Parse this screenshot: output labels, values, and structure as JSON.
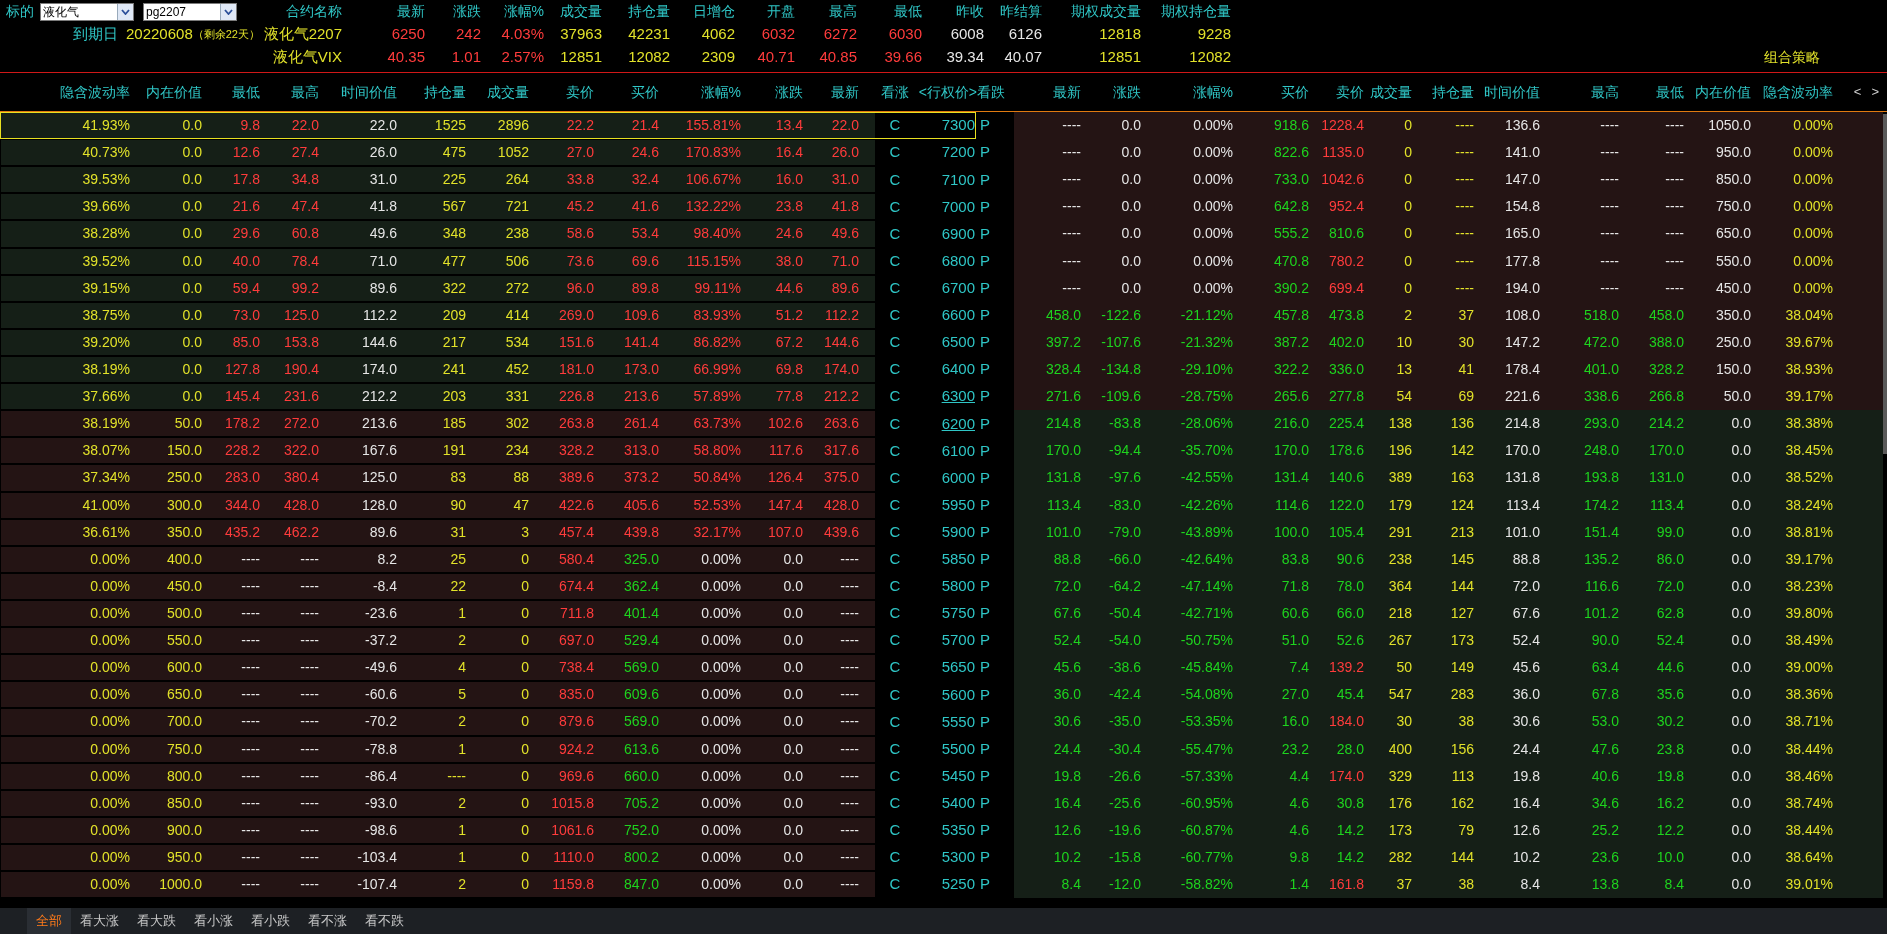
{
  "top": {
    "underlying_label": "标的",
    "underlying_select": "液化气",
    "contract_select": "pg2207",
    "expiry_label": "到期日",
    "expiry_date": "20220608",
    "days_left": "（剩余22天）",
    "columns": [
      "合约名称",
      "最新",
      "涨跌",
      "涨幅%",
      "成交量",
      "持仓量",
      "日增仓",
      "开盘",
      "最高",
      "最低",
      "昨收",
      "昨结算",
      "期权成交量",
      "期权持仓量"
    ],
    "quotes": [
      {
        "name": "液化气2207",
        "values": [
          "6250",
          "242",
          "4.03%",
          "37963",
          "42231",
          "4062",
          "6032",
          "6272",
          "6030",
          "6008",
          "6126",
          "12818",
          "9228"
        ]
      },
      {
        "name": "液化气VIX",
        "values": [
          "40.35",
          "1.01",
          "2.57%",
          "12851",
          "12082",
          "2309",
          "40.71",
          "40.85",
          "39.66",
          "39.34",
          "40.07",
          "12851",
          "12082"
        ]
      }
    ],
    "strategy": "组合策略"
  },
  "table": {
    "call_columns": [
      "隐含波动率",
      "内在价值",
      "最低",
      "最高",
      "时间价值",
      "持仓量",
      "成交量",
      "卖价",
      "买价",
      "涨幅%",
      "涨跌",
      "最新"
    ],
    "middle_columns": [
      "看涨",
      "<行权价>",
      "看跌"
    ],
    "put_columns": [
      "最新",
      "涨跌",
      "涨幅%",
      "买价",
      "卖价",
      "成交量",
      "持仓量",
      "时间价值",
      "最高",
      "最低",
      "内在价值",
      "隐含波动率"
    ],
    "scroll_arrows": [
      "<",
      ">"
    ],
    "rows": [
      {
        "strike": "7300",
        "selected": true,
        "underlined": false,
        "call_itm": false,
        "call_mark": "C",
        "put_mark": "P",
        "call": {
          "up": true,
          "bid_up": true,
          "ask_up": true,
          "values": [
            "41.93%",
            "0.0",
            "9.8",
            "22.0",
            "22.0",
            "1525",
            "2896",
            "22.2",
            "21.4",
            "155.81%",
            "13.4",
            "22.0"
          ]
        },
        "put": {
          "down": false,
          "bid_up": false,
          "ask_up": true,
          "values": [
            "----",
            "0.0",
            "0.00%",
            "918.6",
            "1228.4",
            "0",
            "----",
            "136.6",
            "----",
            "----",
            "1050.0",
            "0.00%"
          ]
        }
      },
      {
        "strike": "7200",
        "selected": false,
        "underlined": false,
        "call_itm": false,
        "call_mark": "C",
        "put_mark": "P",
        "call": {
          "up": true,
          "bid_up": true,
          "ask_up": true,
          "values": [
            "40.73%",
            "0.0",
            "12.6",
            "27.4",
            "26.0",
            "475",
            "1052",
            "27.0",
            "24.6",
            "170.83%",
            "16.4",
            "26.0"
          ]
        },
        "put": {
          "down": false,
          "bid_up": false,
          "ask_up": true,
          "values": [
            "----",
            "0.0",
            "0.00%",
            "822.6",
            "1135.0",
            "0",
            "----",
            "141.0",
            "----",
            "----",
            "950.0",
            "0.00%"
          ]
        }
      },
      {
        "strike": "7100",
        "selected": false,
        "underlined": false,
        "call_itm": false,
        "call_mark": "C",
        "put_mark": "P",
        "call": {
          "up": true,
          "bid_up": true,
          "ask_up": true,
          "values": [
            "39.53%",
            "0.0",
            "17.8",
            "34.8",
            "31.0",
            "225",
            "264",
            "33.8",
            "32.4",
            "106.67%",
            "16.0",
            "31.0"
          ]
        },
        "put": {
          "down": false,
          "bid_up": false,
          "ask_up": true,
          "values": [
            "----",
            "0.0",
            "0.00%",
            "733.0",
            "1042.6",
            "0",
            "----",
            "147.0",
            "----",
            "----",
            "850.0",
            "0.00%"
          ]
        }
      },
      {
        "strike": "7000",
        "selected": false,
        "underlined": false,
        "call_itm": false,
        "call_mark": "C",
        "put_mark": "P",
        "call": {
          "up": true,
          "bid_up": true,
          "ask_up": true,
          "values": [
            "39.66%",
            "0.0",
            "21.6",
            "47.4",
            "41.8",
            "567",
            "721",
            "45.2",
            "41.6",
            "132.22%",
            "23.8",
            "41.8"
          ]
        },
        "put": {
          "down": false,
          "bid_up": false,
          "ask_up": true,
          "values": [
            "----",
            "0.0",
            "0.00%",
            "642.8",
            "952.4",
            "0",
            "----",
            "154.8",
            "----",
            "----",
            "750.0",
            "0.00%"
          ]
        }
      },
      {
        "strike": "6900",
        "selected": false,
        "underlined": false,
        "call_itm": false,
        "call_mark": "C",
        "put_mark": "P",
        "call": {
          "up": true,
          "bid_up": true,
          "ask_up": true,
          "values": [
            "38.28%",
            "0.0",
            "29.6",
            "60.8",
            "49.6",
            "348",
            "238",
            "58.6",
            "53.4",
            "98.40%",
            "24.6",
            "49.6"
          ]
        },
        "put": {
          "down": false,
          "bid_up": false,
          "ask_up": false,
          "values": [
            "----",
            "0.0",
            "0.00%",
            "555.2",
            "810.6",
            "0",
            "----",
            "165.0",
            "----",
            "----",
            "650.0",
            "0.00%"
          ]
        }
      },
      {
        "strike": "6800",
        "selected": false,
        "underlined": false,
        "call_itm": false,
        "call_mark": "C",
        "put_mark": "P",
        "call": {
          "up": true,
          "bid_up": true,
          "ask_up": true,
          "values": [
            "39.52%",
            "0.0",
            "40.0",
            "78.4",
            "71.0",
            "477",
            "506",
            "73.6",
            "69.6",
            "115.15%",
            "38.0",
            "71.0"
          ]
        },
        "put": {
          "down": false,
          "bid_up": false,
          "ask_up": true,
          "values": [
            "----",
            "0.0",
            "0.00%",
            "470.8",
            "780.2",
            "0",
            "----",
            "177.8",
            "----",
            "----",
            "550.0",
            "0.00%"
          ]
        }
      },
      {
        "strike": "6700",
        "selected": false,
        "underlined": false,
        "call_itm": false,
        "call_mark": "C",
        "put_mark": "P",
        "call": {
          "up": true,
          "bid_up": true,
          "ask_up": true,
          "values": [
            "39.15%",
            "0.0",
            "59.4",
            "99.2",
            "89.6",
            "322",
            "272",
            "96.0",
            "89.8",
            "99.11%",
            "44.6",
            "89.6"
          ]
        },
        "put": {
          "down": false,
          "bid_up": false,
          "ask_up": true,
          "values": [
            "----",
            "0.0",
            "0.00%",
            "390.2",
            "699.4",
            "0",
            "----",
            "194.0",
            "----",
            "----",
            "450.0",
            "0.00%"
          ]
        }
      },
      {
        "strike": "6600",
        "selected": false,
        "underlined": false,
        "call_itm": false,
        "call_mark": "C",
        "put_mark": "P",
        "call": {
          "up": true,
          "bid_up": true,
          "ask_up": true,
          "values": [
            "38.75%",
            "0.0",
            "73.0",
            "125.0",
            "112.2",
            "209",
            "414",
            "269.0",
            "109.6",
            "83.93%",
            "51.2",
            "112.2"
          ]
        },
        "put": {
          "down": true,
          "bid_up": false,
          "ask_up": false,
          "values": [
            "458.0",
            "-122.6",
            "-21.12%",
            "457.8",
            "473.8",
            "2",
            "37",
            "108.0",
            "518.0",
            "458.0",
            "350.0",
            "38.04%"
          ]
        }
      },
      {
        "strike": "6500",
        "selected": false,
        "underlined": false,
        "call_itm": false,
        "call_mark": "C",
        "put_mark": "P",
        "call": {
          "up": true,
          "bid_up": true,
          "ask_up": true,
          "values": [
            "39.20%",
            "0.0",
            "85.0",
            "153.8",
            "144.6",
            "217",
            "534",
            "151.6",
            "141.4",
            "86.82%",
            "67.2",
            "144.6"
          ]
        },
        "put": {
          "down": true,
          "bid_up": false,
          "ask_up": false,
          "values": [
            "397.2",
            "-107.6",
            "-21.32%",
            "387.2",
            "402.0",
            "10",
            "30",
            "147.2",
            "472.0",
            "388.0",
            "250.0",
            "39.67%"
          ]
        }
      },
      {
        "strike": "6400",
        "selected": false,
        "underlined": false,
        "call_itm": false,
        "call_mark": "C",
        "put_mark": "P",
        "call": {
          "up": true,
          "bid_up": true,
          "ask_up": true,
          "values": [
            "38.19%",
            "0.0",
            "127.8",
            "190.4",
            "174.0",
            "241",
            "452",
            "181.0",
            "173.0",
            "66.99%",
            "69.8",
            "174.0"
          ]
        },
        "put": {
          "down": true,
          "bid_up": false,
          "ask_up": false,
          "values": [
            "328.4",
            "-134.8",
            "-29.10%",
            "322.2",
            "336.0",
            "13",
            "41",
            "178.4",
            "401.0",
            "328.2",
            "150.0",
            "38.93%"
          ]
        }
      },
      {
        "strike": "6300",
        "selected": false,
        "underlined": true,
        "call_itm": false,
        "call_mark": "C",
        "put_mark": "P",
        "call": {
          "up": true,
          "bid_up": true,
          "ask_up": true,
          "values": [
            "37.66%",
            "0.0",
            "145.4",
            "231.6",
            "212.2",
            "203",
            "331",
            "226.8",
            "213.6",
            "57.89%",
            "77.8",
            "212.2"
          ]
        },
        "put": {
          "down": true,
          "bid_up": false,
          "ask_up": false,
          "values": [
            "271.6",
            "-109.6",
            "-28.75%",
            "265.6",
            "277.8",
            "54",
            "69",
            "221.6",
            "338.6",
            "266.8",
            "50.0",
            "39.17%"
          ]
        }
      },
      {
        "strike": "6200",
        "selected": false,
        "underlined": true,
        "call_itm": true,
        "call_mark": "C",
        "put_mark": "P",
        "call": {
          "up": true,
          "bid_up": true,
          "ask_up": true,
          "values": [
            "38.19%",
            "50.0",
            "178.2",
            "272.0",
            "213.6",
            "185",
            "302",
            "263.8",
            "261.4",
            "63.73%",
            "102.6",
            "263.6"
          ]
        },
        "put": {
          "down": true,
          "bid_up": false,
          "ask_up": false,
          "values": [
            "214.8",
            "-83.8",
            "-28.06%",
            "216.0",
            "225.4",
            "138",
            "136",
            "214.8",
            "293.0",
            "214.2",
            "0.0",
            "38.38%"
          ]
        }
      },
      {
        "strike": "6100",
        "selected": false,
        "underlined": false,
        "call_itm": true,
        "call_mark": "C",
        "put_mark": "P",
        "call": {
          "up": true,
          "bid_up": true,
          "ask_up": true,
          "values": [
            "38.07%",
            "150.0",
            "228.2",
            "322.0",
            "167.6",
            "191",
            "234",
            "328.2",
            "313.0",
            "58.80%",
            "117.6",
            "317.6"
          ]
        },
        "put": {
          "down": true,
          "bid_up": false,
          "ask_up": false,
          "values": [
            "170.0",
            "-94.4",
            "-35.70%",
            "170.0",
            "178.6",
            "196",
            "142",
            "170.0",
            "248.0",
            "170.0",
            "0.0",
            "38.45%"
          ]
        }
      },
      {
        "strike": "6000",
        "selected": false,
        "underlined": false,
        "call_itm": true,
        "call_mark": "C",
        "put_mark": "P",
        "call": {
          "up": true,
          "bid_up": true,
          "ask_up": true,
          "values": [
            "37.34%",
            "250.0",
            "283.0",
            "380.4",
            "125.0",
            "83",
            "88",
            "389.6",
            "373.2",
            "50.84%",
            "126.4",
            "375.0"
          ]
        },
        "put": {
          "down": true,
          "bid_up": false,
          "ask_up": false,
          "values": [
            "131.8",
            "-97.6",
            "-42.55%",
            "131.4",
            "140.6",
            "389",
            "163",
            "131.8",
            "193.8",
            "131.0",
            "0.0",
            "38.52%"
          ]
        }
      },
      {
        "strike": "5950",
        "selected": false,
        "underlined": false,
        "call_itm": true,
        "call_mark": "C",
        "put_mark": "P",
        "call": {
          "up": true,
          "bid_up": true,
          "ask_up": true,
          "values": [
            "41.00%",
            "300.0",
            "344.0",
            "428.0",
            "128.0",
            "90",
            "47",
            "422.6",
            "405.6",
            "52.53%",
            "147.4",
            "428.0"
          ]
        },
        "put": {
          "down": true,
          "bid_up": false,
          "ask_up": false,
          "values": [
            "113.4",
            "-83.0",
            "-42.26%",
            "114.6",
            "122.0",
            "179",
            "124",
            "113.4",
            "174.2",
            "113.4",
            "0.0",
            "38.24%"
          ]
        }
      },
      {
        "strike": "5900",
        "selected": false,
        "underlined": false,
        "call_itm": true,
        "call_mark": "C",
        "put_mark": "P",
        "call": {
          "up": true,
          "bid_up": true,
          "ask_up": true,
          "values": [
            "36.61%",
            "350.0",
            "435.2",
            "462.2",
            "89.6",
            "31",
            "3",
            "457.4",
            "439.8",
            "32.17%",
            "107.0",
            "439.6"
          ]
        },
        "put": {
          "down": true,
          "bid_up": false,
          "ask_up": false,
          "values": [
            "101.0",
            "-79.0",
            "-43.89%",
            "100.0",
            "105.4",
            "291",
            "213",
            "101.0",
            "151.4",
            "99.0",
            "0.0",
            "38.81%"
          ]
        }
      },
      {
        "strike": "5850",
        "selected": false,
        "underlined": false,
        "call_itm": true,
        "call_mark": "C",
        "put_mark": "P",
        "call": {
          "up": false,
          "bid_up": false,
          "ask_up": true,
          "values": [
            "0.00%",
            "400.0",
            "----",
            "----",
            "8.2",
            "25",
            "0",
            "580.4",
            "325.0",
            "0.00%",
            "0.0",
            "----"
          ]
        },
        "put": {
          "down": true,
          "bid_up": false,
          "ask_up": false,
          "values": [
            "88.8",
            "-66.0",
            "-42.64%",
            "83.8",
            "90.6",
            "238",
            "145",
            "88.8",
            "135.2",
            "86.0",
            "0.0",
            "39.17%"
          ]
        }
      },
      {
        "strike": "5800",
        "selected": false,
        "underlined": false,
        "call_itm": true,
        "call_mark": "C",
        "put_mark": "P",
        "call": {
          "up": false,
          "bid_up": false,
          "ask_up": true,
          "values": [
            "0.00%",
            "450.0",
            "----",
            "----",
            "-8.4",
            "22",
            "0",
            "674.4",
            "362.4",
            "0.00%",
            "0.0",
            "----"
          ]
        },
        "put": {
          "down": true,
          "bid_up": false,
          "ask_up": false,
          "values": [
            "72.0",
            "-64.2",
            "-47.14%",
            "71.8",
            "78.0",
            "364",
            "144",
            "72.0",
            "116.6",
            "72.0",
            "0.0",
            "38.23%"
          ]
        }
      },
      {
        "strike": "5750",
        "selected": false,
        "underlined": false,
        "call_itm": true,
        "call_mark": "C",
        "put_mark": "P",
        "call": {
          "up": false,
          "bid_up": false,
          "ask_up": true,
          "values": [
            "0.00%",
            "500.0",
            "----",
            "----",
            "-23.6",
            "1",
            "0",
            "711.8",
            "401.4",
            "0.00%",
            "0.0",
            "----"
          ]
        },
        "put": {
          "down": true,
          "bid_up": false,
          "ask_up": false,
          "values": [
            "67.6",
            "-50.4",
            "-42.71%",
            "60.6",
            "66.0",
            "218",
            "127",
            "67.6",
            "101.2",
            "62.8",
            "0.0",
            "39.80%"
          ]
        }
      },
      {
        "strike": "5700",
        "selected": false,
        "underlined": false,
        "call_itm": true,
        "call_mark": "C",
        "put_mark": "P",
        "call": {
          "up": false,
          "bid_up": false,
          "ask_up": true,
          "values": [
            "0.00%",
            "550.0",
            "----",
            "----",
            "-37.2",
            "2",
            "0",
            "697.0",
            "529.4",
            "0.00%",
            "0.0",
            "----"
          ]
        },
        "put": {
          "down": true,
          "bid_up": false,
          "ask_up": false,
          "values": [
            "52.4",
            "-54.0",
            "-50.75%",
            "51.0",
            "52.6",
            "267",
            "173",
            "52.4",
            "90.0",
            "52.4",
            "0.0",
            "38.49%"
          ]
        }
      },
      {
        "strike": "5650",
        "selected": false,
        "underlined": false,
        "call_itm": true,
        "call_mark": "C",
        "put_mark": "P",
        "call": {
          "up": false,
          "bid_up": false,
          "ask_up": true,
          "values": [
            "0.00%",
            "600.0",
            "----",
            "----",
            "-49.6",
            "4",
            "0",
            "738.4",
            "569.0",
            "0.00%",
            "0.0",
            "----"
          ]
        },
        "put": {
          "down": true,
          "bid_up": false,
          "ask_up": true,
          "values": [
            "45.6",
            "-38.6",
            "-45.84%",
            "7.4",
            "139.2",
            "50",
            "149",
            "45.6",
            "63.4",
            "44.6",
            "0.0",
            "39.00%"
          ]
        }
      },
      {
        "strike": "5600",
        "selected": false,
        "underlined": false,
        "call_itm": true,
        "call_mark": "C",
        "put_mark": "P",
        "call": {
          "up": false,
          "bid_up": false,
          "ask_up": true,
          "values": [
            "0.00%",
            "650.0",
            "----",
            "----",
            "-60.6",
            "5",
            "0",
            "835.0",
            "609.6",
            "0.00%",
            "0.0",
            "----"
          ]
        },
        "put": {
          "down": true,
          "bid_up": false,
          "ask_up": false,
          "values": [
            "36.0",
            "-42.4",
            "-54.08%",
            "27.0",
            "45.4",
            "547",
            "283",
            "36.0",
            "67.8",
            "35.6",
            "0.0",
            "38.36%"
          ]
        }
      },
      {
        "strike": "5550",
        "selected": false,
        "underlined": false,
        "call_itm": true,
        "call_mark": "C",
        "put_mark": "P",
        "call": {
          "up": false,
          "bid_up": false,
          "ask_up": true,
          "values": [
            "0.00%",
            "700.0",
            "----",
            "----",
            "-70.2",
            "2",
            "0",
            "879.6",
            "569.0",
            "0.00%",
            "0.0",
            "----"
          ]
        },
        "put": {
          "down": true,
          "bid_up": false,
          "ask_up": true,
          "values": [
            "30.6",
            "-35.0",
            "-53.35%",
            "16.0",
            "184.0",
            "30",
            "38",
            "30.6",
            "53.0",
            "30.2",
            "0.0",
            "38.71%"
          ]
        }
      },
      {
        "strike": "5500",
        "selected": false,
        "underlined": false,
        "call_itm": true,
        "call_mark": "C",
        "put_mark": "P",
        "call": {
          "up": false,
          "bid_up": false,
          "ask_up": true,
          "values": [
            "0.00%",
            "750.0",
            "----",
            "----",
            "-78.8",
            "1",
            "0",
            "924.2",
            "613.6",
            "0.00%",
            "0.0",
            "----"
          ]
        },
        "put": {
          "down": true,
          "bid_up": false,
          "ask_up": false,
          "values": [
            "24.4",
            "-30.4",
            "-55.47%",
            "23.2",
            "28.0",
            "400",
            "156",
            "24.4",
            "47.6",
            "23.8",
            "0.0",
            "38.44%"
          ]
        }
      },
      {
        "strike": "5450",
        "selected": false,
        "underlined": false,
        "call_itm": true,
        "call_mark": "C",
        "put_mark": "P",
        "call": {
          "up": false,
          "bid_up": false,
          "ask_up": true,
          "values": [
            "0.00%",
            "800.0",
            "----",
            "----",
            "-86.4",
            "----",
            "0",
            "969.6",
            "660.0",
            "0.00%",
            "0.0",
            "----"
          ]
        },
        "put": {
          "down": true,
          "bid_up": false,
          "ask_up": true,
          "values": [
            "19.8",
            "-26.6",
            "-57.33%",
            "4.4",
            "174.0",
            "329",
            "113",
            "19.8",
            "40.6",
            "19.8",
            "0.0",
            "38.46%"
          ]
        }
      },
      {
        "strike": "5400",
        "selected": false,
        "underlined": false,
        "call_itm": true,
        "call_mark": "C",
        "put_mark": "P",
        "call": {
          "up": false,
          "bid_up": false,
          "ask_up": true,
          "values": [
            "0.00%",
            "850.0",
            "----",
            "----",
            "-93.0",
            "2",
            "0",
            "1015.8",
            "705.2",
            "0.00%",
            "0.0",
            "----"
          ]
        },
        "put": {
          "down": true,
          "bid_up": false,
          "ask_up": false,
          "values": [
            "16.4",
            "-25.6",
            "-60.95%",
            "4.6",
            "30.8",
            "176",
            "162",
            "16.4",
            "34.6",
            "16.2",
            "0.0",
            "38.74%"
          ]
        }
      },
      {
        "strike": "5350",
        "selected": false,
        "underlined": false,
        "call_itm": true,
        "call_mark": "C",
        "put_mark": "P",
        "call": {
          "up": false,
          "bid_up": false,
          "ask_up": true,
          "values": [
            "0.00%",
            "900.0",
            "----",
            "----",
            "-98.6",
            "1",
            "0",
            "1061.6",
            "752.0",
            "0.00%",
            "0.0",
            "----"
          ]
        },
        "put": {
          "down": true,
          "bid_up": false,
          "ask_up": false,
          "values": [
            "12.6",
            "-19.6",
            "-60.87%",
            "4.6",
            "14.2",
            "173",
            "79",
            "12.6",
            "25.2",
            "12.2",
            "0.0",
            "38.44%"
          ]
        }
      },
      {
        "strike": "5300",
        "selected": false,
        "underlined": false,
        "call_itm": true,
        "call_mark": "C",
        "put_mark": "P",
        "call": {
          "up": false,
          "bid_up": false,
          "ask_up": true,
          "values": [
            "0.00%",
            "950.0",
            "----",
            "----",
            "-103.4",
            "1",
            "0",
            "1110.0",
            "800.2",
            "0.00%",
            "0.0",
            "----"
          ]
        },
        "put": {
          "down": true,
          "bid_up": false,
          "ask_up": false,
          "values": [
            "10.2",
            "-15.8",
            "-60.77%",
            "9.8",
            "14.2",
            "282",
            "144",
            "10.2",
            "23.6",
            "10.0",
            "0.0",
            "38.64%"
          ]
        }
      },
      {
        "strike": "5250",
        "selected": false,
        "underlined": false,
        "call_itm": true,
        "call_mark": "C",
        "put_mark": "P",
        "call": {
          "up": false,
          "bid_up": false,
          "ask_up": true,
          "values": [
            "0.00%",
            "1000.0",
            "----",
            "----",
            "-107.4",
            "2",
            "0",
            "1159.8",
            "847.0",
            "0.00%",
            "0.0",
            "----"
          ]
        },
        "put": {
          "down": true,
          "bid_up": false,
          "ask_up": true,
          "values": [
            "8.4",
            "-12.0",
            "-58.82%",
            "1.4",
            "161.8",
            "37",
            "38",
            "8.4",
            "13.8",
            "8.4",
            "0.0",
            "39.01%"
          ]
        }
      }
    ]
  },
  "filter_tabs": [
    {
      "label": "全部",
      "selected": true
    },
    {
      "label": "看大涨",
      "selected": false
    },
    {
      "label": "看大跌",
      "selected": false
    },
    {
      "label": "看小涨",
      "selected": false
    },
    {
      "label": "看小跌",
      "selected": false
    },
    {
      "label": "看不涨",
      "selected": false
    },
    {
      "label": "看不跌",
      "selected": false
    }
  ]
}
